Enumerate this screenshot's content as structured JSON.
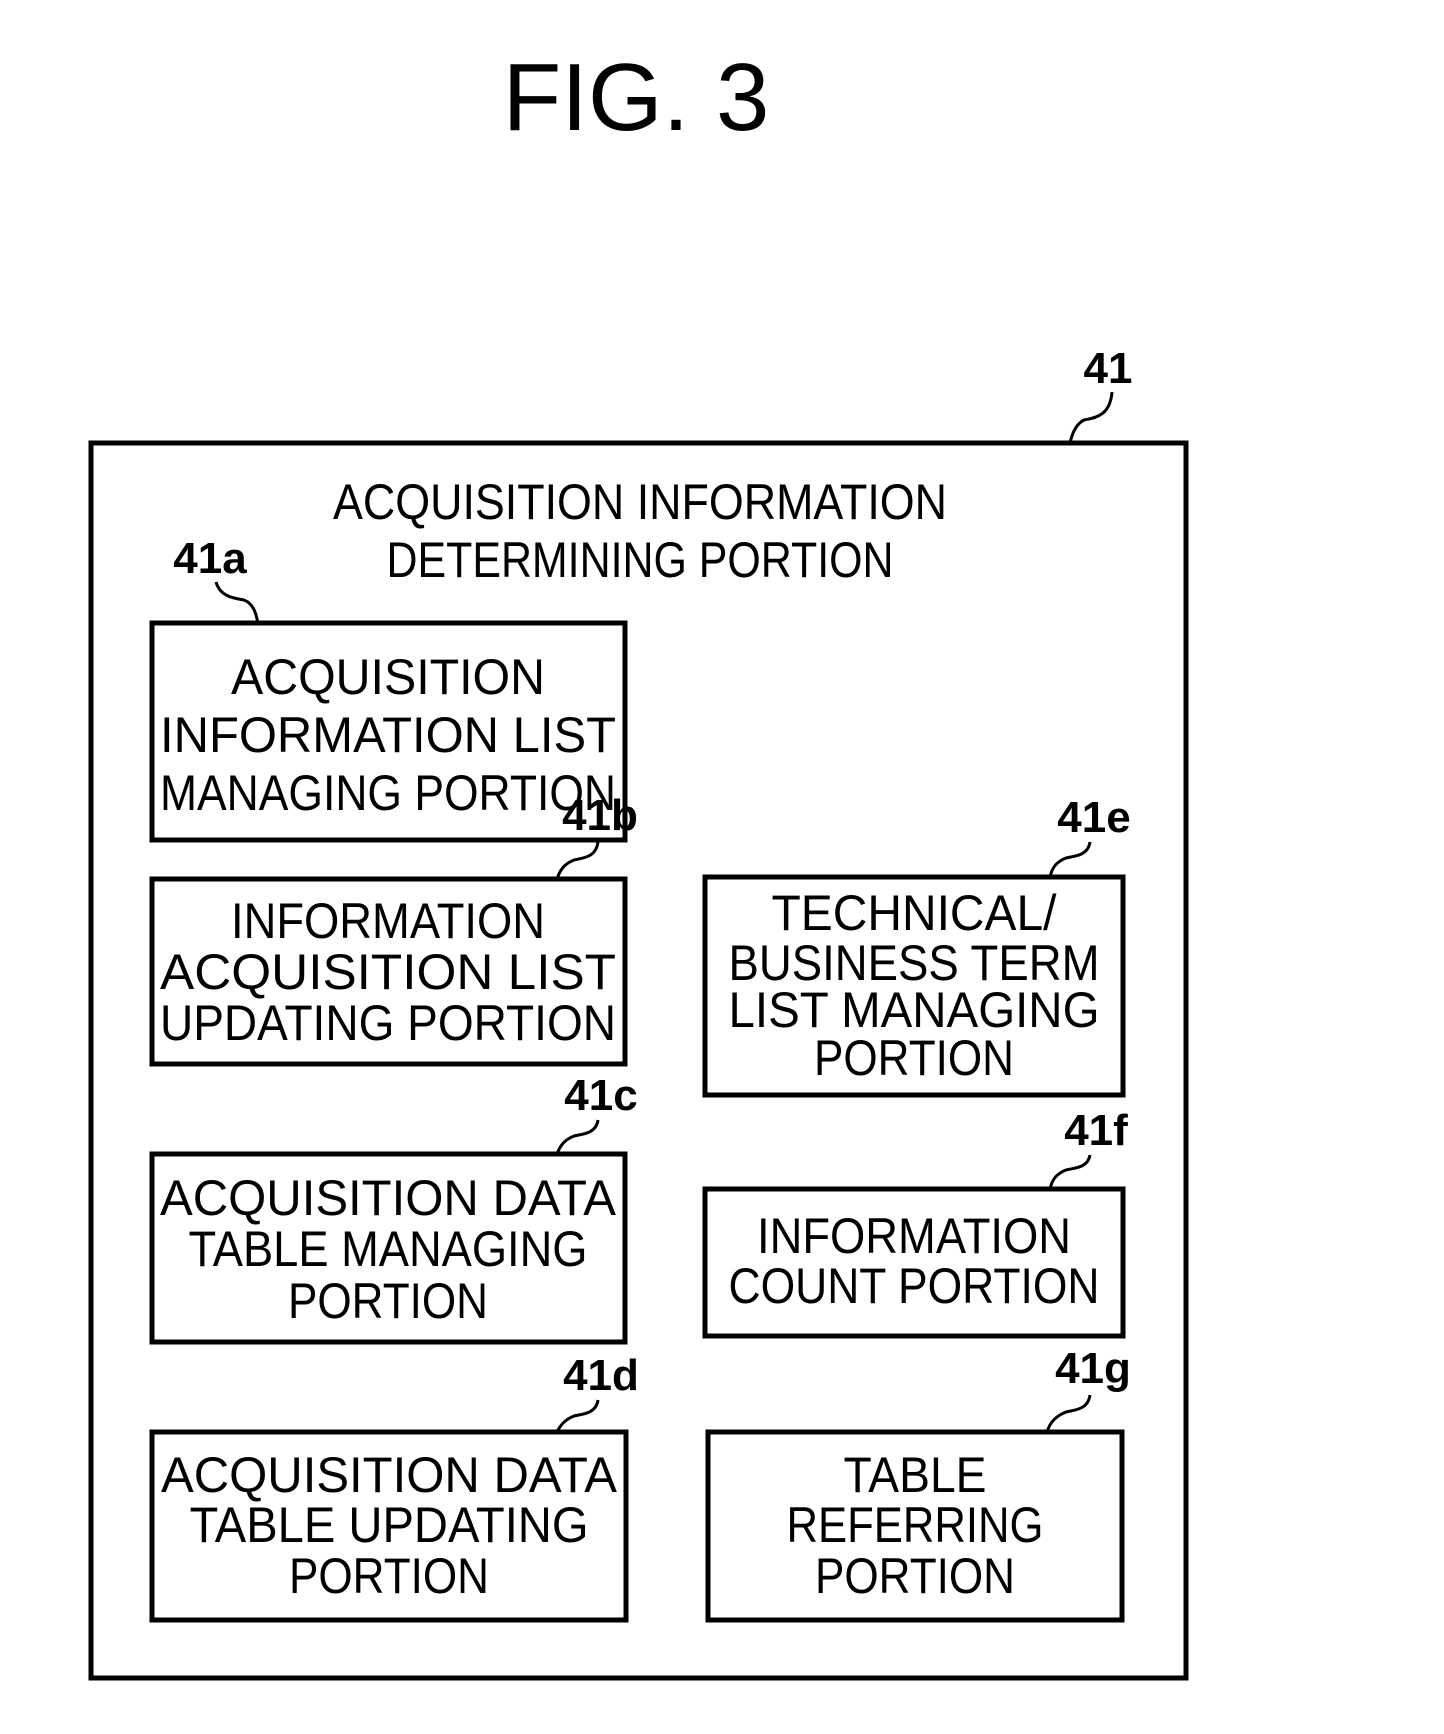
{
  "figure": {
    "title": "FIG. 3",
    "outer": {
      "ref": "41",
      "lines": [
        "ACQUISITION INFORMATION",
        "DETERMINING PORTION"
      ]
    },
    "blocks": [
      {
        "ref": "41a",
        "lines": [
          "ACQUISITION",
          "INFORMATION LIST",
          "MANAGING PORTION"
        ]
      },
      {
        "ref": "41b",
        "lines": [
          "INFORMATION",
          "ACQUISITION LIST",
          "UPDATING PORTION"
        ]
      },
      {
        "ref": "41c",
        "lines": [
          "ACQUISITION DATA",
          "TABLE MANAGING",
          "PORTION"
        ]
      },
      {
        "ref": "41d",
        "lines": [
          "ACQUISITION DATA",
          "TABLE UPDATING",
          "PORTION"
        ]
      },
      {
        "ref": "41e",
        "lines": [
          "TECHNICAL/",
          "BUSINESS TERM",
          "LIST MANAGING",
          "PORTION"
        ]
      },
      {
        "ref": "41f",
        "lines": [
          "INFORMATION",
          "COUNT PORTION"
        ]
      },
      {
        "ref": "41g",
        "lines": [
          "TABLE",
          "REFERRING",
          "PORTION"
        ]
      }
    ]
  }
}
